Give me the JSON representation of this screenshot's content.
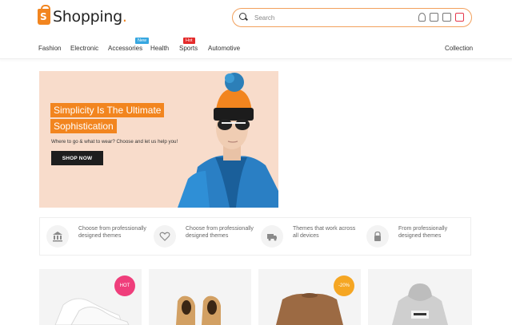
{
  "header": {
    "logo_text": "Shopping",
    "logo_dot": ".",
    "logo_bag_letter": "S",
    "search_placeholder": "Search",
    "icons": [
      "user-icon",
      "compare-icon",
      "wishlist-icon",
      "cart-icon"
    ]
  },
  "nav": {
    "items": [
      {
        "label": "Fashion"
      },
      {
        "label": "Electronic"
      },
      {
        "label": "Accessories",
        "badge": "New",
        "badge_color": "#37a7e0"
      },
      {
        "label": "Health"
      },
      {
        "label": "Sports",
        "badge": "Hot",
        "badge_color": "#e42b2b"
      },
      {
        "label": "Automotive"
      }
    ],
    "right_item": "Collection"
  },
  "hero": {
    "title_line1": "Simplicity Is The Ultimate",
    "title_line2": "Sophistication",
    "subtitle": "Where to go & what to wear? Choose and let us help you!",
    "button": "SHOP NOW",
    "accent": "#f2851f"
  },
  "features": [
    {
      "icon": "bank-icon",
      "text": "Choose from professionally designed themes"
    },
    {
      "icon": "heart-icon",
      "text": "Choose from professionally designed themes"
    },
    {
      "icon": "truck-icon",
      "text": "Themes that work across all devices"
    },
    {
      "icon": "lock-icon",
      "text": "From professionally designed themes"
    }
  ],
  "products": [
    {
      "name": "sneakers",
      "tag": "HOT",
      "tag_color": "#ef3e7b"
    },
    {
      "name": "boots"
    },
    {
      "name": "sweater",
      "tag": "-20%",
      "tag_color": "#f5a623"
    },
    {
      "name": "hoodie"
    }
  ]
}
